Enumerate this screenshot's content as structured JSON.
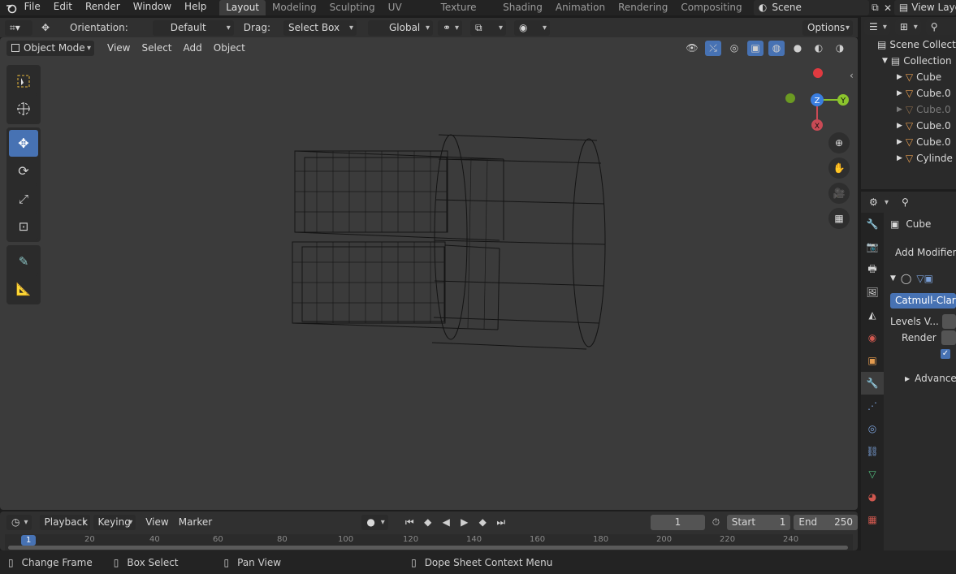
{
  "menu": {
    "items": [
      "File",
      "Edit",
      "Render",
      "Window",
      "Help"
    ]
  },
  "workspaces": [
    {
      "label": "Layout",
      "active": true
    },
    {
      "label": "Modeling"
    },
    {
      "label": "Sculpting"
    },
    {
      "label": "UV Editing"
    },
    {
      "label": "Texture Paint"
    },
    {
      "label": "Shading"
    },
    {
      "label": "Animation"
    },
    {
      "label": "Rendering"
    },
    {
      "label": "Compositing"
    }
  ],
  "scene": {
    "name": "Scene",
    "view_layer": "View Layer"
  },
  "tool_header": {
    "orientation_label": "Orientation:",
    "orientation_value": "Default",
    "drag_label": "Drag:",
    "drag_value": "Select Box",
    "transform_value": "Global",
    "options_label": "Options"
  },
  "viewport_header": {
    "mode": "Object Mode",
    "menus": [
      "View",
      "Select",
      "Add",
      "Object"
    ]
  },
  "gizmo": {
    "x": "X",
    "y": "Y",
    "z": "Z"
  },
  "timeline": {
    "menus": [
      "Playback",
      "Keying",
      "View",
      "Marker"
    ],
    "current_frame": "1",
    "start_label": "Start",
    "start": "1",
    "end_label": "End",
    "end": "250",
    "ruler": [
      "1",
      "20",
      "40",
      "60",
      "80",
      "100",
      "120",
      "140",
      "160",
      "180",
      "200",
      "220",
      "240"
    ]
  },
  "status": {
    "items": [
      "Change Frame",
      "Box Select",
      "Pan View",
      "Dope Sheet Context Menu"
    ]
  },
  "outliner": {
    "scene_collection": "Scene Collection",
    "collection": "Collection",
    "objects": [
      "Cube",
      "Cube.0",
      "Cube.0",
      "Cube.0",
      "Cube.0",
      "Cylinde"
    ]
  },
  "properties": {
    "object_name": "Cube",
    "add_modifier": "Add Modifier",
    "modifier_name": "Catmull-Clark",
    "levels_label": "Levels V...",
    "render_label": "Render",
    "advanced_label": "Advanced"
  },
  "colors": {
    "accent": "#4772b3",
    "x_axis": "#c94a55",
    "y_axis": "#8bc42d",
    "z_axis": "#3a7ee0"
  }
}
